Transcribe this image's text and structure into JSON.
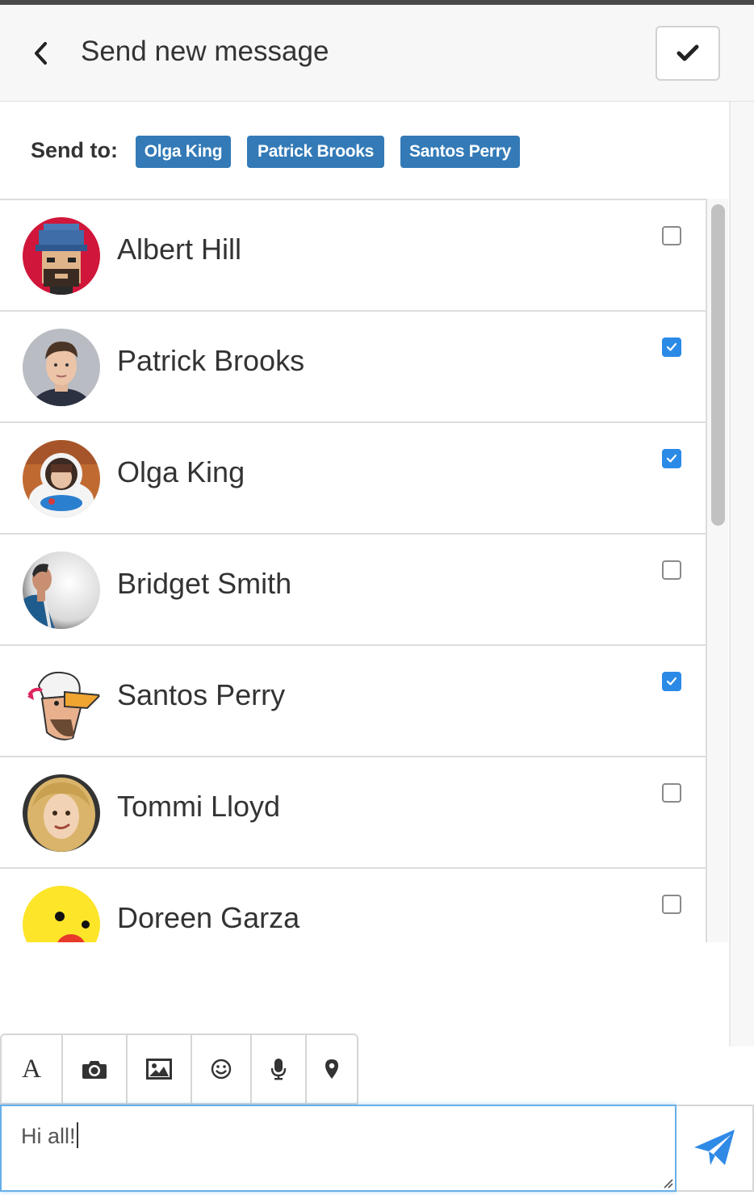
{
  "header": {
    "title": "Send new message",
    "back_icon": "chevron-left-icon",
    "confirm_icon": "check-icon"
  },
  "send_to": {
    "label": "Send to:",
    "recipients": [
      "Olga King",
      "Patrick Brooks",
      "Santos Perry"
    ],
    "tag_color": "#337ab7"
  },
  "contacts": [
    {
      "name": "Albert Hill",
      "checked": false
    },
    {
      "name": "Patrick Brooks",
      "checked": true
    },
    {
      "name": "Olga King",
      "checked": true
    },
    {
      "name": "Bridget Smith",
      "checked": false
    },
    {
      "name": "Santos Perry",
      "checked": true
    },
    {
      "name": "Tommi Lloyd",
      "checked": false
    },
    {
      "name": "Doreen Garza",
      "checked": false
    }
  ],
  "toolbar": {
    "font_label": "A",
    "icons": [
      "font-icon",
      "camera-icon",
      "image-icon",
      "smile-icon",
      "microphone-icon",
      "map-marker-icon"
    ]
  },
  "composer": {
    "value": "Hi all!"
  },
  "colors": {
    "accent": "#2b8ae6",
    "send": "#2f8ae6"
  }
}
